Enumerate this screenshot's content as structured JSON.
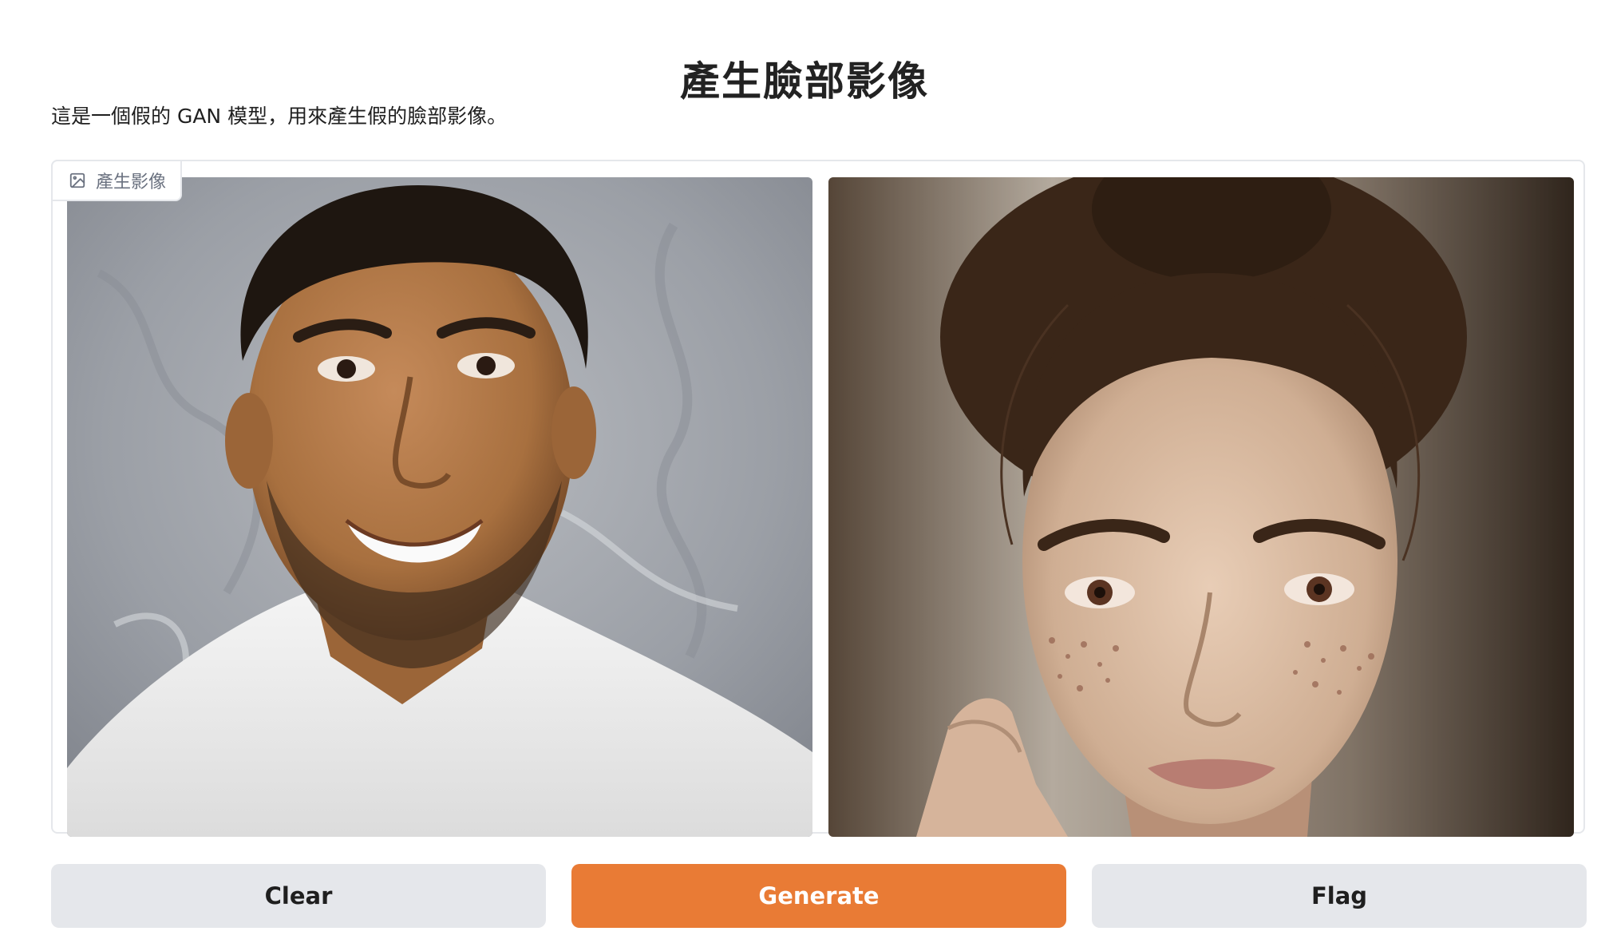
{
  "app": {
    "title": "產生臉部影像",
    "description": "這是一個假的 GAN 模型，用來產生假的臉部影像。"
  },
  "gallery": {
    "label": "產生影像",
    "label_icon": "image-icon",
    "images": [
      {
        "subject": "smiling man with dark hair and stubble wearing a white v-neck t-shirt, grey marble background"
      },
      {
        "subject": "young woman with freckles and hair in a bun, hand on cheek, dark blurred background"
      }
    ]
  },
  "actions": {
    "clear_label": "Clear",
    "generate_label": "Generate",
    "flag_label": "Flag"
  },
  "colors": {
    "primary_button": "#e97b35",
    "secondary_button": "#e5e7eb"
  }
}
